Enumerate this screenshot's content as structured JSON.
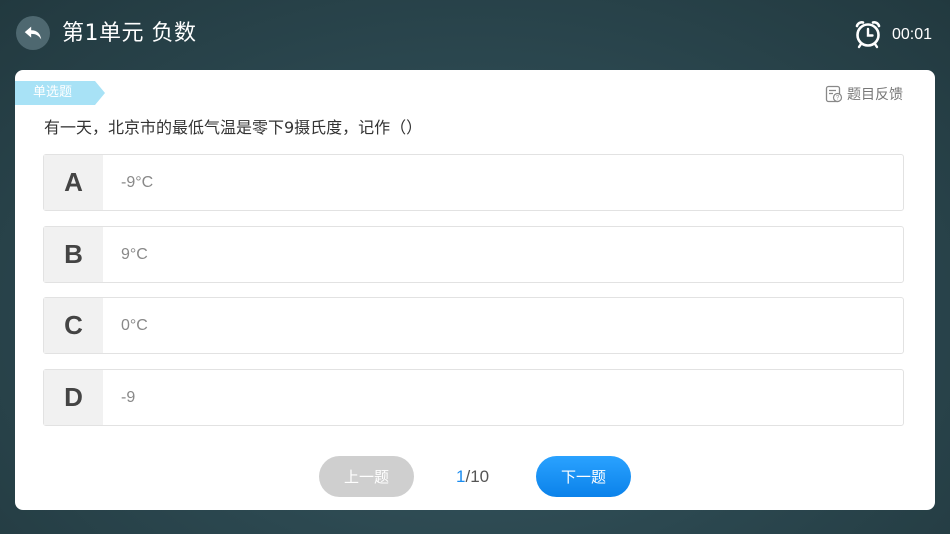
{
  "header": {
    "title": "第1单元 负数",
    "timer": "00:01"
  },
  "question": {
    "type_label": "单选题",
    "feedback_label": "题目反馈",
    "text": "有一天，北京市的最低气温是零下9摄氏度，记作（）",
    "options": [
      {
        "letter": "A",
        "text": "-9°C"
      },
      {
        "letter": "B",
        "text": "9°C"
      },
      {
        "letter": "C",
        "text": "0°C"
      },
      {
        "letter": "D",
        "text": "-9"
      }
    ]
  },
  "footer": {
    "prev_label": "上一题",
    "next_label": "下一题",
    "current_page": "1",
    "total_pages": "/10"
  },
  "colors": {
    "accent": "#1a8cf0",
    "tag": "#a8e2f6"
  }
}
